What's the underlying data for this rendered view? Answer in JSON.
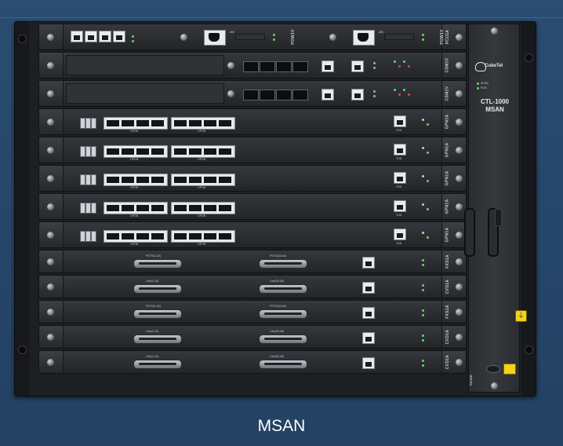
{
  "caption": "MSAN",
  "panel": {
    "brand": "CubeTel",
    "model_line1": "CTL-1000",
    "model_line2": "MSAN",
    "led1": "ALRM",
    "led2": "RUN",
    "filter_label": "FILTER"
  },
  "colors": {
    "background": "#2b4d72",
    "chassis": "#1d1f22",
    "caption_text": "#ffffff",
    "led_green": "#6bd46b",
    "caution_yellow": "#f2d315"
  },
  "slots": [
    {
      "label": "PCU1A",
      "kind": "pcu"
    },
    {
      "label": "CSM1V",
      "kind": "csm"
    },
    {
      "label": "CSM1V",
      "kind": "csm"
    },
    {
      "label": "GPN1A",
      "kind": "gpon",
      "port_label": "GPON",
      "eth_label": "TUN"
    },
    {
      "label": "GPN1A",
      "kind": "gpon",
      "port_label": "GPON",
      "eth_label": "TUN"
    },
    {
      "label": "GPN1A",
      "kind": "gpon",
      "port_label": "GPON",
      "eth_label": "TUN"
    },
    {
      "label": "GPN1A",
      "kind": "gpon",
      "port_label": "GPON",
      "eth_label": "TUN"
    },
    {
      "label": "GPN1A",
      "kind": "gpon",
      "port_label": "GPON",
      "eth_label": "TUN"
    },
    {
      "label": "FXS1A",
      "kind": "dsub",
      "left_label": "POTS(1-32)",
      "right_label": "POTS(33-64)"
    },
    {
      "label": "CVD1A",
      "kind": "dsub",
      "left_label": "Line(1-24)",
      "right_label": "Line(25-48)"
    },
    {
      "label": "FXS1A",
      "kind": "dsub",
      "left_label": "POTS(1-32)",
      "right_label": "POTS(33-64)"
    },
    {
      "label": "CVD1A",
      "kind": "dsub",
      "left_label": "Line(1-24)",
      "right_label": "Line(25-48)"
    },
    {
      "label": "CVD1A",
      "kind": "dsub",
      "left_label": "Line(1-24)",
      "right_label": "Line(25-48)"
    }
  ],
  "power_modules": [
    {
      "label": "POW1V",
      "vin": "-48V"
    },
    {
      "label": "POW1V",
      "vin": "-48V"
    }
  ]
}
